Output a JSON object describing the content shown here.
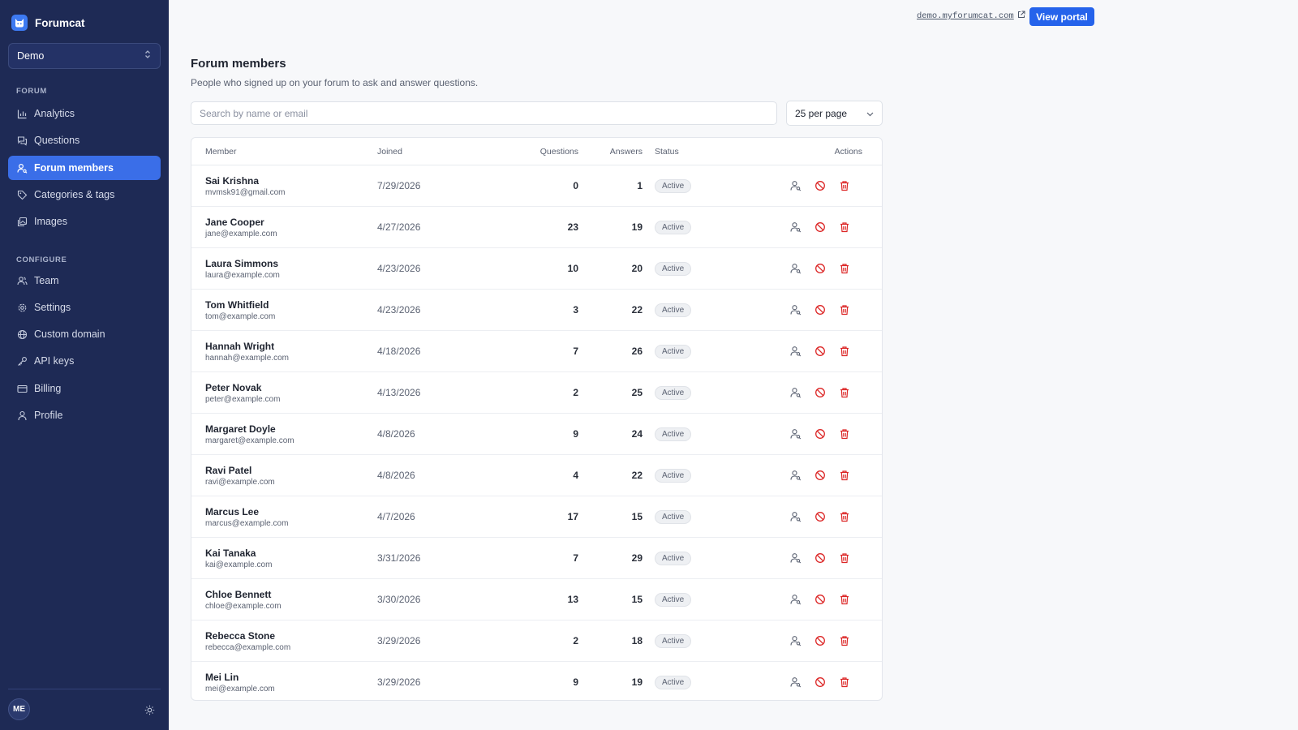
{
  "app": {
    "name": "Forumcat"
  },
  "workspace": {
    "selected": "Demo"
  },
  "sidebar": {
    "sections": [
      {
        "title": "FORUM",
        "items": [
          {
            "label": "Analytics",
            "icon": "bar-chart-icon"
          },
          {
            "label": "Questions",
            "icon": "chat-icon"
          },
          {
            "label": "Forum members",
            "icon": "user-search-icon",
            "active": true
          },
          {
            "label": "Categories & tags",
            "icon": "tag-icon"
          },
          {
            "label": "Images",
            "icon": "images-icon"
          }
        ]
      },
      {
        "title": "CONFIGURE",
        "items": [
          {
            "label": "Team",
            "icon": "users-icon"
          },
          {
            "label": "Settings",
            "icon": "gear-icon"
          },
          {
            "label": "Custom domain",
            "icon": "globe-icon"
          },
          {
            "label": "API keys",
            "icon": "key-icon"
          },
          {
            "label": "Billing",
            "icon": "credit-card-icon"
          },
          {
            "label": "Profile",
            "icon": "user-icon"
          }
        ]
      }
    ],
    "user_initials": "ME"
  },
  "topbar": {
    "portal_url": "demo.myforumcat.com",
    "view_portal": "View portal"
  },
  "page": {
    "title": "Forum members",
    "subtitle": "People who signed up on your forum to ask and answer questions.",
    "search_placeholder": "Search by name or email",
    "per_page": "25 per page"
  },
  "table": {
    "columns": {
      "member": "Member",
      "joined": "Joined",
      "questions": "Questions",
      "answers": "Answers",
      "status": "Status",
      "actions": "Actions"
    },
    "rows": [
      {
        "name": "Sai Krishna",
        "email": "mvmsk91@gmail.com",
        "joined": "7/29/2026",
        "questions": "0",
        "answers": "1",
        "status": "Active"
      },
      {
        "name": "Jane Cooper",
        "email": "jane@example.com",
        "joined": "4/27/2026",
        "questions": "23",
        "answers": "19",
        "status": "Active"
      },
      {
        "name": "Laura Simmons",
        "email": "laura@example.com",
        "joined": "4/23/2026",
        "questions": "10",
        "answers": "20",
        "status": "Active"
      },
      {
        "name": "Tom Whitfield",
        "email": "tom@example.com",
        "joined": "4/23/2026",
        "questions": "3",
        "answers": "22",
        "status": "Active"
      },
      {
        "name": "Hannah Wright",
        "email": "hannah@example.com",
        "joined": "4/18/2026",
        "questions": "7",
        "answers": "26",
        "status": "Active"
      },
      {
        "name": "Peter Novak",
        "email": "peter@example.com",
        "joined": "4/13/2026",
        "questions": "2",
        "answers": "25",
        "status": "Active"
      },
      {
        "name": "Margaret Doyle",
        "email": "margaret@example.com",
        "joined": "4/8/2026",
        "questions": "9",
        "answers": "24",
        "status": "Active"
      },
      {
        "name": "Ravi Patel",
        "email": "ravi@example.com",
        "joined": "4/8/2026",
        "questions": "4",
        "answers": "22",
        "status": "Active"
      },
      {
        "name": "Marcus Lee",
        "email": "marcus@example.com",
        "joined": "4/7/2026",
        "questions": "17",
        "answers": "15",
        "status": "Active"
      },
      {
        "name": "Kai Tanaka",
        "email": "kai@example.com",
        "joined": "3/31/2026",
        "questions": "7",
        "answers": "29",
        "status": "Active"
      },
      {
        "name": "Chloe Bennett",
        "email": "chloe@example.com",
        "joined": "3/30/2026",
        "questions": "13",
        "answers": "15",
        "status": "Active"
      },
      {
        "name": "Rebecca Stone",
        "email": "rebecca@example.com",
        "joined": "3/29/2026",
        "questions": "2",
        "answers": "18",
        "status": "Active"
      },
      {
        "name": "Mei Lin",
        "email": "mei@example.com",
        "joined": "3/29/2026",
        "questions": "9",
        "answers": "19",
        "status": "Active"
      }
    ]
  },
  "colors": {
    "sidebar_bg": "#1e2a55",
    "accent": "#2563eb",
    "danger": "#dc2626"
  }
}
